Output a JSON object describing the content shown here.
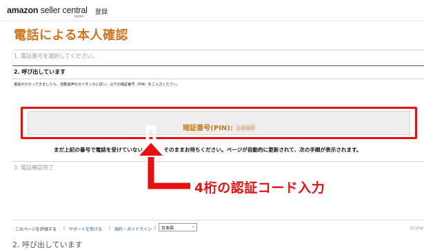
{
  "header": {
    "logo_amazon": "amazon",
    "logo_seller": " seller central",
    "logo_region": "japan",
    "signin_label": "登録"
  },
  "page_title": "電話による本人確認",
  "steps": {
    "step1": "1. 電話番号を選択してください。",
    "step2": "2. 呼び出しています",
    "step3": "3. 電話確認完了"
  },
  "instruction": "電話がかかってきましたら、自動音声のガイダンスに従い、以下の暗証番号（PIN）をご入力ください。",
  "pin": {
    "label": "暗証番号(PIN):",
    "value": "1448"
  },
  "wait_message": "まだ上記の番号で電話を受けていない場合は、そのままお待ちください。ページが自動的に更新されて、次の手順が表示されます。",
  "annotation": {
    "text": "4桁の認証コード入力",
    "color": "#e8100f"
  },
  "footer": {
    "rate_page": "このページを評価する",
    "get_support": "サポートを受ける",
    "policies": "規約・ガイドライン",
    "separator": "|",
    "language": "日本語",
    "feedback_id": "ECstarts"
  },
  "bottom_cut_text": "2. 呼び出しています",
  "colors": {
    "title_orange": "#d1741f",
    "highlight_red": "#e8100f",
    "link_blue": "#1f5fa8"
  }
}
